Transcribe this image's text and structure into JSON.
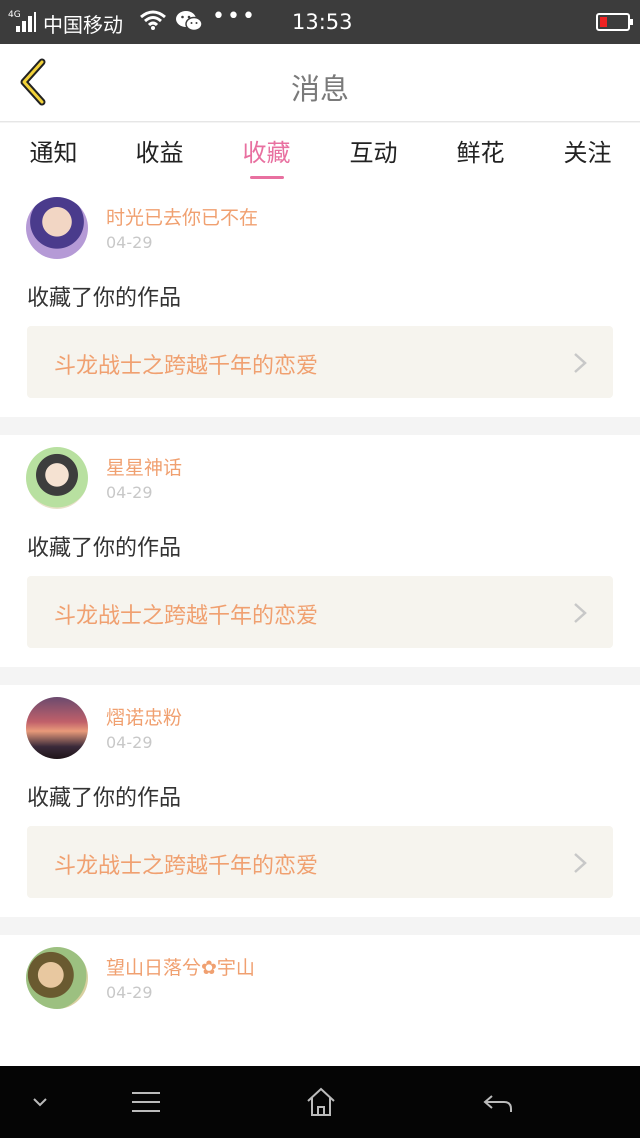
{
  "status_bar": {
    "network": "4G",
    "carrier": "中国移动",
    "dots": "•••",
    "time": "13:53",
    "battery_color": "#e22222",
    "icons": [
      "signal-icon",
      "wifi-icon",
      "wechat-icon",
      "battery-icon"
    ]
  },
  "header": {
    "back_icon": "back-chevron-icon",
    "title": "消息"
  },
  "tabs": [
    {
      "label": "通知",
      "active": false
    },
    {
      "label": "收益",
      "active": false
    },
    {
      "label": "收藏",
      "active": true
    },
    {
      "label": "互动",
      "active": false
    },
    {
      "label": "鲜花",
      "active": false
    },
    {
      "label": "关注",
      "active": false
    }
  ],
  "colors": {
    "accent": "#e870a0",
    "username": "#f0a070",
    "work_bg": "#f6f4ee"
  },
  "feed": [
    {
      "username": "时光已去你已不在",
      "date": "04-29",
      "action": "收藏了你的作品",
      "work_title": "斗龙战士之跨越千年的恋爱"
    },
    {
      "username": "星星神话",
      "date": "04-29",
      "action": "收藏了你的作品",
      "work_title": "斗龙战士之跨越千年的恋爱"
    },
    {
      "username": "熠诺忠粉",
      "date": "04-29",
      "action": "收藏了你的作品",
      "work_title": "斗龙战士之跨越千年的恋爱"
    },
    {
      "username": "望山日落兮✿宇山",
      "date": "04-29"
    }
  ],
  "nav_bar": {
    "icons": [
      "collapse-icon",
      "menu-icon",
      "home-icon",
      "back-arrow-icon"
    ]
  }
}
